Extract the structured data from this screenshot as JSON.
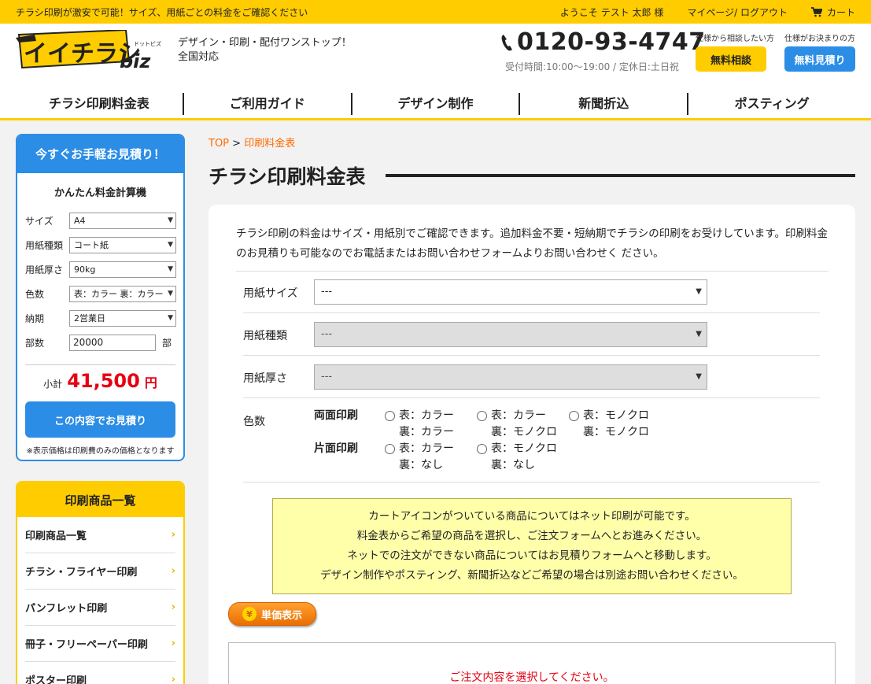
{
  "topbar": {
    "message": "チラシ印刷が激安で可能！サイズ、用紙ごとの料金をご確認ください",
    "welcome": "ようこそ テスト 太郎 様",
    "mypage": "マイページ/ ログアウト",
    "cart": "カート"
  },
  "header": {
    "logo_text": "イイチラシ",
    "logo_sub": "biz",
    "logo_small": "ドットビズ",
    "tagline1": "デザイン・印刷・配付ワンストップ！",
    "tagline2": "全国対応",
    "phone": "0120-93-4747",
    "hours": "受付時間:10:00〜19:00 / 定休日:土日祝",
    "cta1_small": "仕様から相談したい方",
    "cta1_label": "無料相談",
    "cta2_small": "仕様がお決まりの方",
    "cta2_label": "無料見積り"
  },
  "nav": [
    "チラシ印刷料金表",
    "ご利用ガイド",
    "デザイン制作",
    "新聞折込",
    "ポスティング"
  ],
  "estimator": {
    "head": "今すぐお手軽お見積り！",
    "sub": "かんたん料金計算機",
    "size_label": "サイズ",
    "size_value": "A4",
    "paper_label": "用紙種類",
    "paper_value": "コート紙",
    "weight_label": "用紙厚さ",
    "weight_value": "90kg",
    "color_label": "色数",
    "color_value": "表：カラー 裏：カラー",
    "delivery_label": "納期",
    "delivery_value": "2営業日",
    "qty_label": "部数",
    "qty_value": "20000",
    "qty_unit": "部",
    "subtotal_label": "小計",
    "subtotal_value": "41,500",
    "subtotal_unit": "円",
    "button": "この内容でお見積り",
    "note": "※表示価格は印刷費のみの価格となります"
  },
  "catlist": {
    "head": "印刷商品一覧",
    "items": [
      "印刷商品一覧",
      "チラシ・フライヤー印刷",
      "パンフレット印刷",
      "冊子・フリーペーパー印刷",
      "ポスター印刷"
    ]
  },
  "breadcrumb": {
    "top": "TOP",
    "sep": ">",
    "current": "印刷料金表"
  },
  "page_title": "チラシ印刷料金表",
  "intro": "チラシ印刷の料金はサイズ・用紙別でご確認できます。追加料金不要・短納期でチラシの印刷をお受けしています。印刷料金のお見積りも可能なのでお電話またはお問い合わせフォームよりお問い合わせく ださい。",
  "form": {
    "size_label": "用紙サイズ",
    "size_value": "---",
    "type_label": "用紙種類",
    "type_value": "---",
    "weight_label": "用紙厚さ",
    "weight_value": "---",
    "color_label": "色数",
    "double_label": "両面印刷",
    "single_label": "片面印刷",
    "opt_dc_f": "表：カラー",
    "opt_dc_b": "裏：カラー",
    "opt_dm_f": "表：カラー",
    "opt_dm_b": "裏：モノクロ",
    "opt_mm_f": "表：モノクロ",
    "opt_mm_b": "裏：モノクロ",
    "opt_sc_f": "表：カラー",
    "opt_sc_b": "裏：なし",
    "opt_sm_f": "表：モノクロ",
    "opt_sm_b": "裏：なし"
  },
  "notice": {
    "line1": "カートアイコンがついている商品についてはネット印刷が可能です。",
    "line2": "料金表からご希望の商品を選択し、ご注文フォームへとお進みください。",
    "line3": "ネットでの注文ができない商品についてはお見積りフォームへと移動します。",
    "line4": "デザイン制作やポスティング、新聞折込などご希望の場合は別途お問い合わせください。"
  },
  "unit_button": "単価表示",
  "unit_icon": "¥",
  "result_message": "ご注文内容を選択してください。",
  "colors": {
    "accent_yellow": "#ffcc00",
    "accent_blue": "#2b8de6",
    "price_red": "#e60012",
    "link_orange": "#ff6a00"
  }
}
